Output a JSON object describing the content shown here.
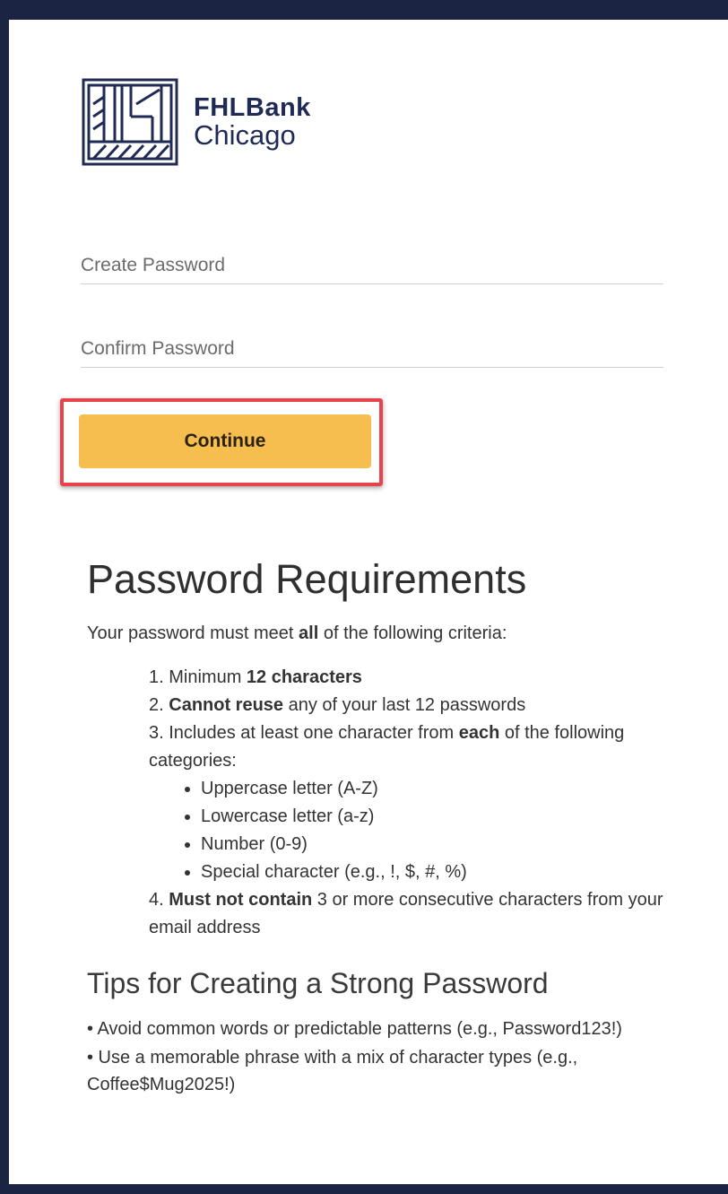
{
  "brand": {
    "line1": "FHLBank",
    "line2": "Chicago",
    "color": "#1f2a55"
  },
  "form": {
    "create_placeholder": "Create Password",
    "confirm_placeholder": "Confirm Password",
    "continue_label": "Continue",
    "button_color": "#f6be4f",
    "highlight_color": "#e8434b"
  },
  "requirements": {
    "title": "Password Requirements",
    "intro_pre": "Your password must meet ",
    "intro_bold": "all",
    "intro_post": " of the following criteria:",
    "r1_pre": "1. Minimum ",
    "r1_bold": "12 characters",
    "r2_pre": "2. ",
    "r2_bold": "Cannot reuse",
    "r2_post": " any of your last 12 passwords",
    "r3_pre": "3. Includes at least one character from ",
    "r3_bold": "each",
    "r3_post": " of the following categories:",
    "categories": [
      "Uppercase letter (A-Z)",
      "Lowercase letter (a-z)",
      "Number (0-9)",
      "Special character (e.g., !, $, #, %)"
    ],
    "r4_pre": "4. ",
    "r4_bold": "Must not contain",
    "r4_post": " 3 or more consecutive characters from your email address"
  },
  "tips": {
    "title": "Tips for Creating a Strong Password",
    "items": [
      "•   Avoid common words or predictable patterns (e.g., Password123!)",
      "•   Use a memorable phrase with a mix of character types (e.g., Coffee$Mug2025!)"
    ]
  }
}
